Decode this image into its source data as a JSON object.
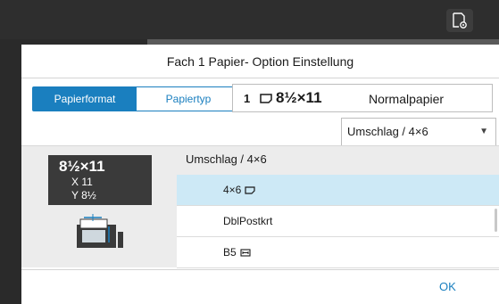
{
  "dialog": {
    "title": "Fach 1 Papier- Option Einstellung",
    "tabs": [
      "Papierformat",
      "Papiertyp"
    ],
    "active_tab": "Papierformat"
  },
  "info": {
    "tray": "1",
    "size": "8½×11",
    "type": "Normalpapier"
  },
  "dropdown": {
    "selected": "Umschlag / 4×6"
  },
  "size_card": {
    "main": "8½×11",
    "x": "X 11",
    "y": "Y 8½"
  },
  "list": {
    "header": "Umschlag / 4×6",
    "items": [
      {
        "label": "4×6",
        "icon": "paper-landscape-icon",
        "selected": true
      },
      {
        "label": "DblPostkrt",
        "icon": "",
        "selected": false
      },
      {
        "label": "B5",
        "icon": "paper-width-icon",
        "selected": false
      }
    ]
  },
  "footer": {
    "ok_label": "OK"
  },
  "colors": {
    "accent": "#1a7fbf",
    "selected_row": "#cde9f6"
  }
}
